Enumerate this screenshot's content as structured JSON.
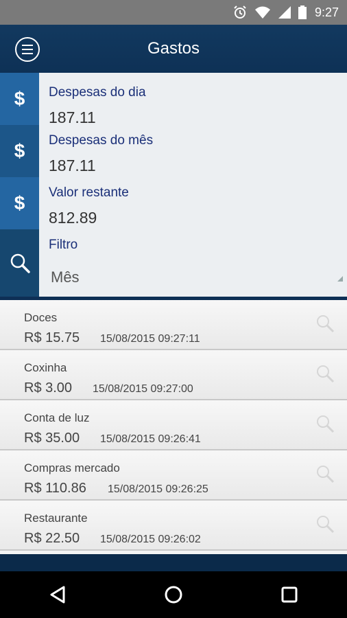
{
  "status_bar": {
    "time": "9:27",
    "icons": [
      "alarm-icon",
      "wifi-icon",
      "signal-icon",
      "battery-icon"
    ]
  },
  "app_bar": {
    "title": "Gastos",
    "menu_icon": "menu-icon"
  },
  "summary": {
    "daily_label": "Despesas do dia",
    "daily_value": "187.11",
    "monthly_label": "Despesas do mês",
    "monthly_value": "187.11",
    "remaining_label": "Valor restante",
    "remaining_value": "812.89",
    "filter_label": "Filtro",
    "filter_value": "Mês",
    "currency_symbol": "$"
  },
  "expenses": [
    {
      "name": "Doces",
      "amount": "R$ 15.75",
      "datetime": "15/08/2015 09:27:11"
    },
    {
      "name": "Coxinha",
      "amount": "R$ 3.00",
      "datetime": "15/08/2015 09:27:00"
    },
    {
      "name": "Conta de luz",
      "amount": "R$ 35.00",
      "datetime": "15/08/2015 09:26:41"
    },
    {
      "name": "Compras mercado",
      "amount": "R$ 110.86",
      "datetime": "15/08/2015 09:26:25"
    },
    {
      "name": "Restaurante",
      "amount": "R$ 22.50",
      "datetime": "15/08/2015 09:26:02"
    }
  ],
  "nav_bar": {
    "icons": [
      "back-icon",
      "home-icon",
      "recents-icon"
    ]
  },
  "colors": {
    "primary": "#0e3156",
    "accent_blue": "#2466a2",
    "label_blue": "#1a2f78",
    "status_bar": "#7a7a7a"
  }
}
